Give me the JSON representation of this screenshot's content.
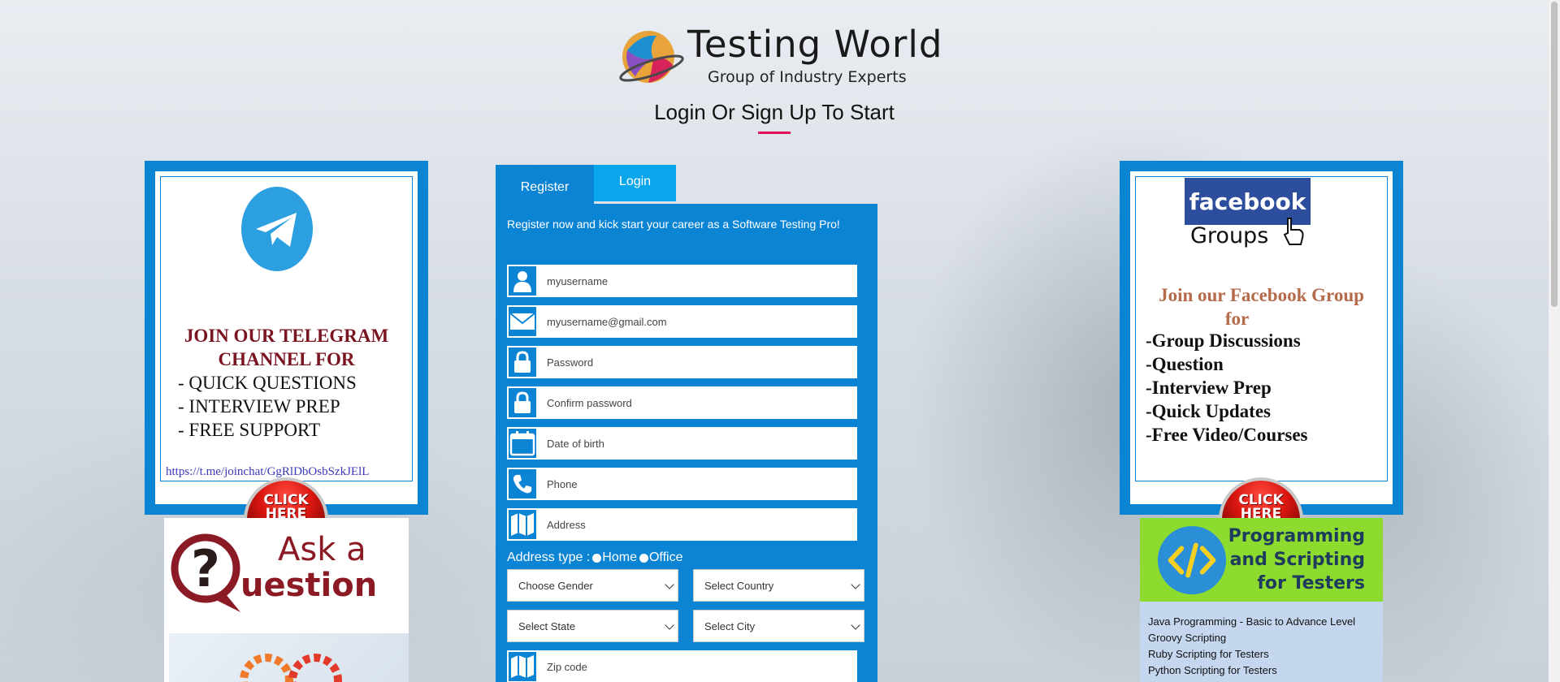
{
  "header": {
    "brand_title": "Testing World",
    "brand_subtitle": "Group of Industry Experts",
    "heading": "Login Or Sign Up To Start",
    "accent_color": "#e2125a"
  },
  "telegram_ad": {
    "icon": "telegram-icon",
    "title_line1": "JOIN OUR TELEGRAM",
    "title_line2": "CHANNEL  FOR",
    "items": [
      "- QUICK QUESTIONS",
      "- INTERVIEW PREP",
      "- FREE SUPPORT"
    ],
    "link": "https://t.me/joinchat/GgRlDbOsbSzkJElL",
    "cta_line1": "CLICK",
    "cta_line2": "HERE"
  },
  "facebook_ad": {
    "logo_text": "facebook",
    "logo_sub": "Groups",
    "title_line1": "Join our Facebook Group",
    "title_line2": "for",
    "items": [
      "-Group Discussions",
      "-Question",
      "-Interview Prep",
      "-Quick Updates",
      "-Free Video/Courses"
    ],
    "cta_line1": "CLICK",
    "cta_line2": "HERE"
  },
  "ask_ad": {
    "line1": "Ask a",
    "line2": "uestion"
  },
  "programming_ad": {
    "title_line1": "Programming",
    "title_line2": "and Scripting",
    "title_line3": "for Testers",
    "items": [
      "Java Programming - Basic to Advance Level",
      "Groovy Scripting",
      "Ruby Scripting for Testers",
      "Python Scripting for Testers"
    ]
  },
  "tabs": {
    "register": "Register",
    "login": "Login"
  },
  "form": {
    "intro": "Register now and kick start your career as a Software Testing Pro!",
    "username_placeholder": "myusername",
    "email_placeholder": "myusername@gmail.com",
    "password_placeholder": "Password",
    "confirm_placeholder": "Confirm password",
    "dob_placeholder": "Date of birth",
    "phone_placeholder": "Phone",
    "address_placeholder": "Address",
    "address_type_label": "Address type :",
    "address_type_home": "Home",
    "address_type_office": "Office",
    "gender_select": "Choose Gender",
    "country_select": "Select Country",
    "state_select": "Select State",
    "city_select": "Select City",
    "zip_placeholder": "Zip code"
  }
}
